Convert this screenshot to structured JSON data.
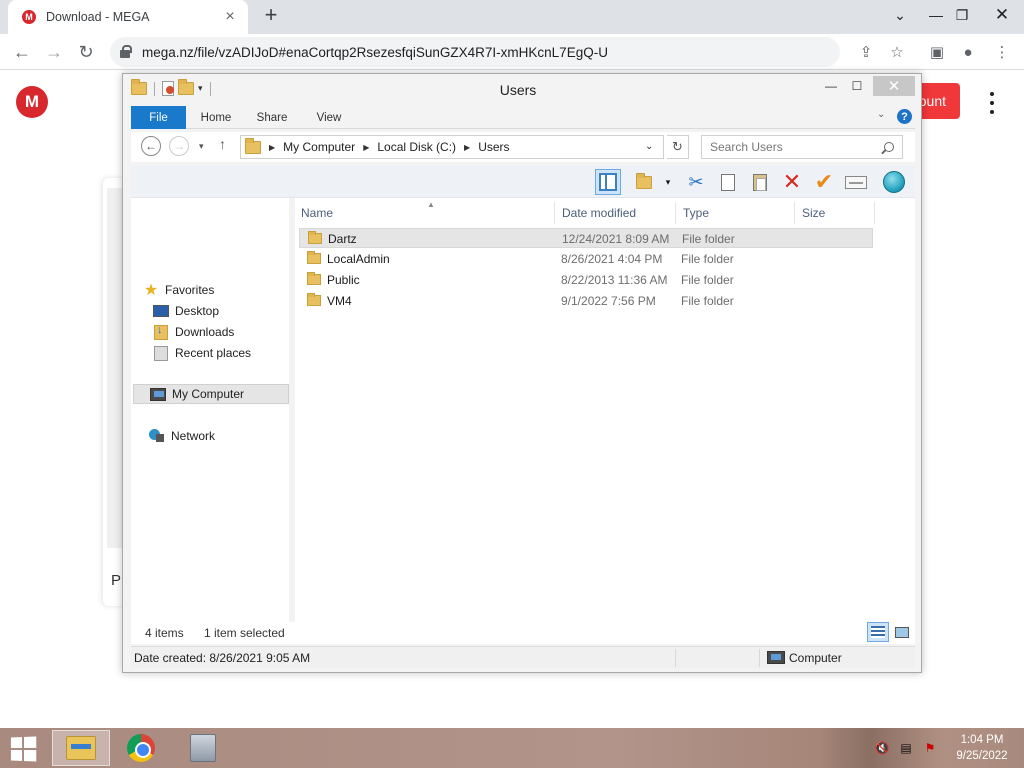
{
  "browser": {
    "tab_title": "Download - MEGA",
    "url": "mega.nz/file/vzADIJoD#enaCortqp2RsezesfqiSunGZX4R7I-xmHKcnL7EgQ-U"
  },
  "mega": {
    "button_text": "ount",
    "panel_text": "P"
  },
  "explorer": {
    "title": "Users",
    "ribbon_tabs": [
      "File",
      "Home",
      "Share",
      "View"
    ],
    "breadcrumb": [
      "My Computer",
      "Local Disk (C:)",
      "Users"
    ],
    "search_placeholder": "Search Users",
    "nav": {
      "favorites": "Favorites",
      "desktop": "Desktop",
      "downloads": "Downloads",
      "recent": "Recent places",
      "computer": "My Computer",
      "network": "Network"
    },
    "columns": [
      "Name",
      "Date modified",
      "Type",
      "Size"
    ],
    "files": [
      {
        "name": "Dartz",
        "date": "12/24/2021 8:09 AM",
        "type": "File folder"
      },
      {
        "name": "LocalAdmin",
        "date": "8/26/2021 4:04 PM",
        "type": "File folder"
      },
      {
        "name": "Public",
        "date": "8/22/2013 11:36 AM",
        "type": "File folder"
      },
      {
        "name": "VM4",
        "date": "9/1/2022 7:56 PM",
        "type": "File folder"
      }
    ],
    "status": {
      "item_count": "4 items",
      "selected": "1 item selected",
      "date_created": "Date created: 8/26/2021 9:05 AM",
      "location": "Computer"
    }
  },
  "taskbar": {
    "time": "1:04 PM",
    "date": "9/25/2022"
  },
  "colors": {
    "mega_red": "#d9272e",
    "ribbon_file_blue": "#1979ca",
    "selection_gray": "#e5e5e5"
  }
}
